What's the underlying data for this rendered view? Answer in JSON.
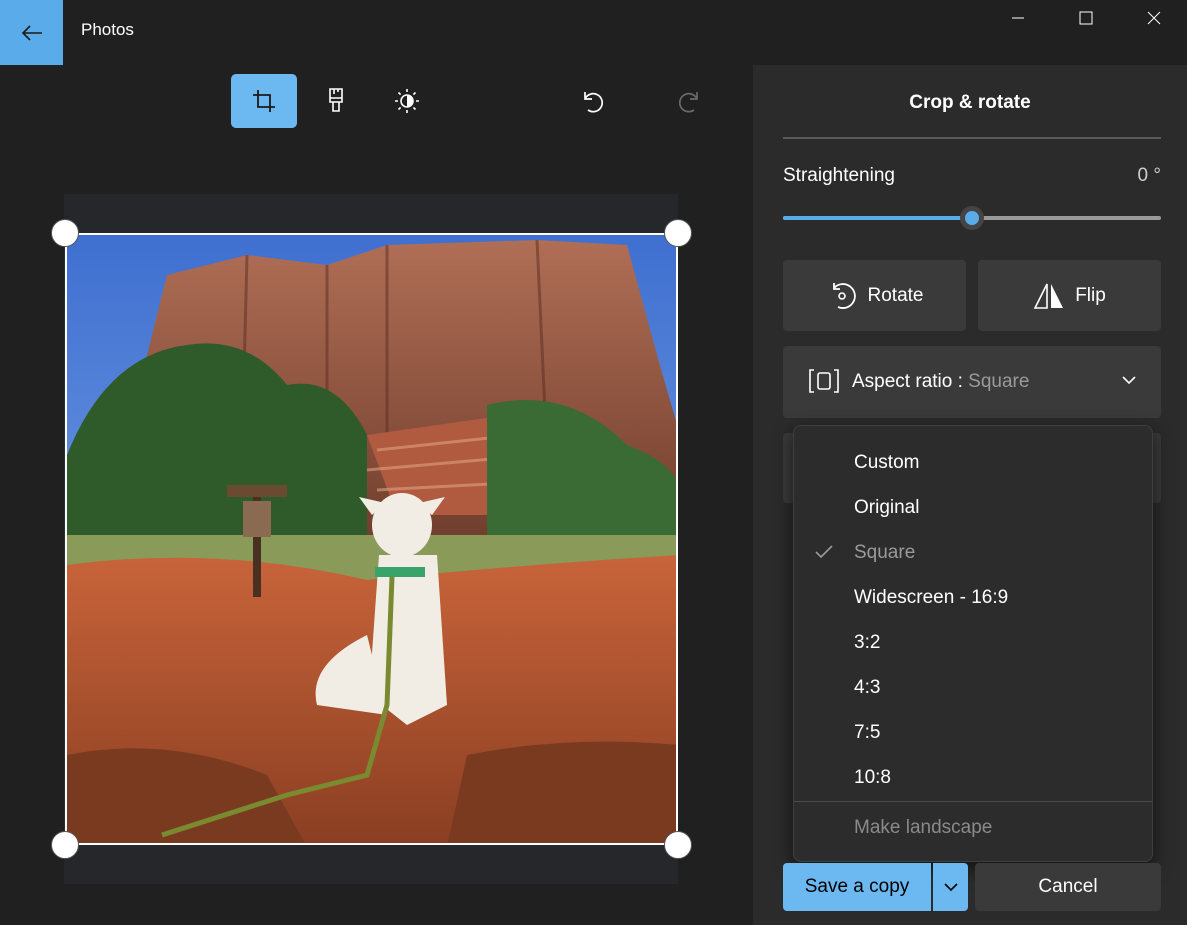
{
  "titlebar": {
    "app_title": "Photos",
    "back_icon": "arrow-left-icon",
    "minimize_icon": "minimize-icon",
    "maximize_icon": "maximize-icon",
    "close_icon": "close-icon"
  },
  "toolbar": {
    "crop_icon": "crop-icon",
    "markup_icon": "brush-icon",
    "adjust_icon": "brightness-icon",
    "undo_icon": "undo-icon",
    "redo_icon": "redo-icon",
    "active_tool": "crop"
  },
  "panel": {
    "title": "Crop & rotate",
    "straightening_label": "Straightening",
    "straightening_value": "0 °",
    "straightening_fraction": 0.5,
    "rotate_label": "Rotate",
    "flip_label": "Flip",
    "aspect_label": "Aspect ratio :",
    "aspect_value": "Square"
  },
  "dropdown": {
    "items": [
      {
        "label": "Custom",
        "selected": false
      },
      {
        "label": "Original",
        "selected": false
      },
      {
        "label": "Square",
        "selected": true
      },
      {
        "label": "Widescreen - 16:9",
        "selected": false
      },
      {
        "label": "3:2",
        "selected": false
      },
      {
        "label": "4:3",
        "selected": false
      },
      {
        "label": "7:5",
        "selected": false
      },
      {
        "label": "10:8",
        "selected": false
      }
    ],
    "landscape_label": "Make landscape"
  },
  "footer": {
    "save_label": "Save a copy",
    "cancel_label": "Cancel"
  },
  "colors": {
    "accent": "#6cb8f0",
    "background": "#202020",
    "panel": "#2b2b2b"
  }
}
